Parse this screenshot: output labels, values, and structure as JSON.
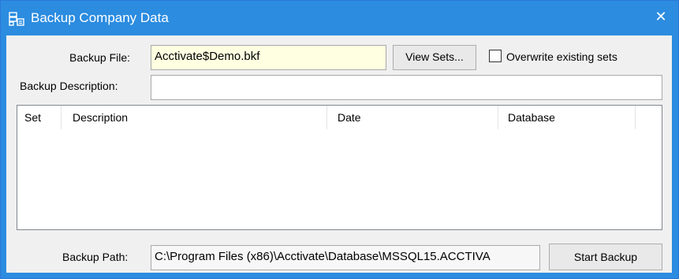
{
  "window": {
    "title": "Backup Company Data",
    "close_glyph": "✕",
    "icon": "database-backup-icon"
  },
  "form": {
    "backup_file_label": "Backup File:",
    "backup_file_value": "Acctivate$Demo.bkf",
    "view_sets_label": "View Sets...",
    "overwrite_label": "Overwrite existing sets",
    "overwrite_checked": false,
    "backup_description_label": "Backup Description:",
    "backup_description_value": "",
    "backup_path_label": "Backup Path:",
    "backup_path_value": "C:\\Program Files (x86)\\Acctivate\\Database\\MSSQL15.ACCTIVA",
    "start_backup_label": "Start Backup"
  },
  "sets_list": {
    "columns": [
      "Set",
      "Description",
      "Date",
      "Database"
    ],
    "rows": []
  },
  "colors": {
    "titlebar": "#2b8ce0",
    "highlight_field": "#ffffe1"
  }
}
